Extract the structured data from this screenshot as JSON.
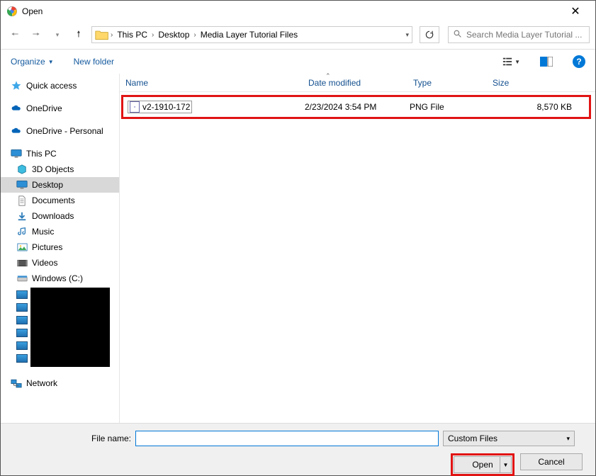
{
  "window": {
    "title": "Open"
  },
  "breadcrumb": {
    "items": [
      "This PC",
      "Desktop",
      "Media Layer Tutorial Files"
    ]
  },
  "search": {
    "placeholder": "Search Media Layer Tutorial ..."
  },
  "toolbar": {
    "organize": "Organize",
    "newfolder": "New folder"
  },
  "sidebar": {
    "quickaccess": "Quick access",
    "onedrive": "OneDrive",
    "onedrive_personal": "OneDrive - Personal",
    "thispc": "This PC",
    "objects3d": "3D Objects",
    "desktop": "Desktop",
    "documents": "Documents",
    "downloads": "Downloads",
    "music": "Music",
    "pictures": "Pictures",
    "videos": "Videos",
    "windowsc": "Windows (C:)",
    "network": "Network"
  },
  "columns": {
    "name": "Name",
    "date": "Date modified",
    "type": "Type",
    "size": "Size"
  },
  "files": [
    {
      "name": "v2-1910-172",
      "date": "2/23/2024 3:54 PM",
      "type": "PNG File",
      "size": "8,570 KB"
    }
  ],
  "footer": {
    "filename_label": "File name:",
    "filename_value": "",
    "filetype": "Custom Files",
    "open": "Open",
    "cancel": "Cancel"
  }
}
